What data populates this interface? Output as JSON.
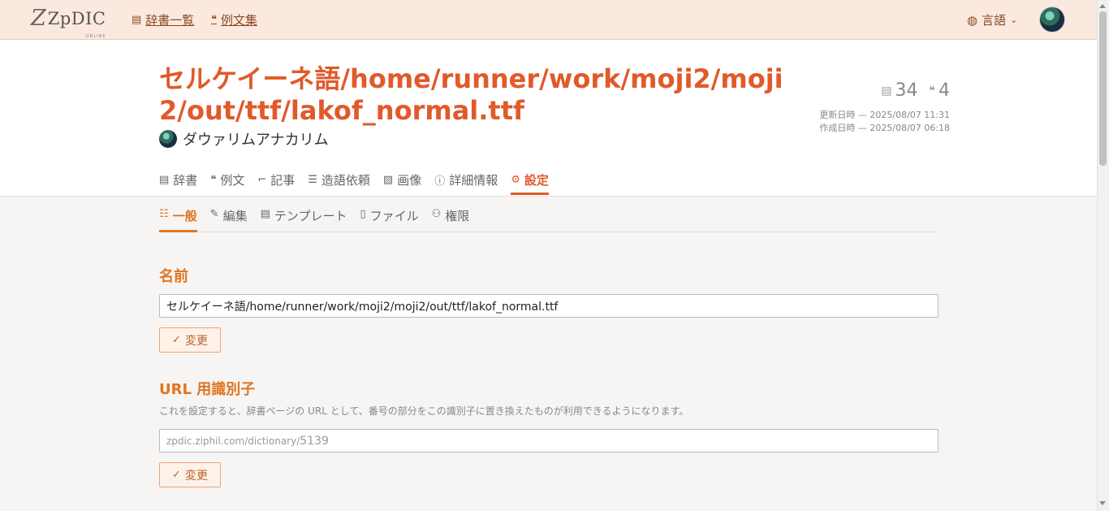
{
  "header": {
    "logo": "ZpDIC",
    "logo_sub": "ONLINE",
    "nav": [
      {
        "label": "辞書一覧",
        "icon": "book-icon"
      },
      {
        "label": "例文集",
        "icon": "quote-icon"
      }
    ],
    "language_label": "言語"
  },
  "dictionary": {
    "title": "セルケイーネ語/home/runner/work/moji2/moji2/out/ttf/lakof_normal.ttf",
    "owner": "ダウァリムアナカリム",
    "word_count": "34",
    "example_count": "4",
    "updated": "更新日時 — 2025/08/07 11:31",
    "created": "作成日時 — 2025/08/07 06:18"
  },
  "tabs": [
    {
      "label": "辞書",
      "icon": "book-icon"
    },
    {
      "label": "例文",
      "icon": "quote-icon"
    },
    {
      "label": "記事",
      "icon": "scroll-icon"
    },
    {
      "label": "造語依頼",
      "icon": "list-icon"
    },
    {
      "label": "画像",
      "icon": "image-icon"
    },
    {
      "label": "詳細情報",
      "icon": "info-icon"
    },
    {
      "label": "設定",
      "icon": "gear-icon",
      "active": true
    }
  ],
  "subtabs": [
    {
      "label": "一般",
      "icon": "sliders-icon",
      "active": true
    },
    {
      "label": "編集",
      "icon": "pencil-icon"
    },
    {
      "label": "テンプレート",
      "icon": "template-icon"
    },
    {
      "label": "ファイル",
      "icon": "file-icon"
    },
    {
      "label": "権限",
      "icon": "users-icon"
    }
  ],
  "settings": {
    "name": {
      "title": "名前",
      "value": "セルケイーネ語/home/runner/work/moji2/moji2/out/ttf/lakof_normal.ttf",
      "button": "変更"
    },
    "url_id": {
      "title": "URL 用識別子",
      "description": "これを設定すると、辞書ページの URL として、番号の部分をこの識別子に置き換えたものが利用できるようになります。",
      "prefix": "zpdic.ziphil.com/dictionary/",
      "placeholder": "5139",
      "button": "変更"
    }
  },
  "colors": {
    "accent": "#e05a2a",
    "section_accent": "#e07520",
    "header_bg": "#fbe9df"
  }
}
